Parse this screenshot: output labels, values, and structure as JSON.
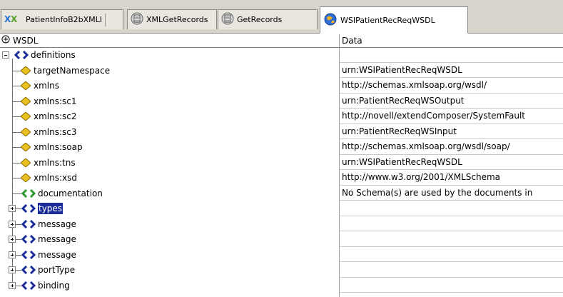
{
  "tabs": [
    {
      "label": "PatientInfoB2bXMLI",
      "icon": "xml-map-icon",
      "active": false
    },
    {
      "label": "XMLGetRecords",
      "icon": "database-component-icon",
      "active": false
    },
    {
      "label": "GetRecords",
      "icon": "database-component-icon",
      "active": false
    },
    {
      "label": "WSIPatientRecReqWSDL",
      "icon": "wsdl-globe-icon",
      "active": true
    }
  ],
  "header": {
    "tree_col": "WSDL",
    "data_col": "Data"
  },
  "rows": [
    {
      "label": "definitions",
      "kind": "element",
      "level": 0,
      "data": ""
    },
    {
      "label": "targetNamespace",
      "kind": "attribute",
      "level": 1,
      "data": "urn:WSIPatientRecReqWSDL"
    },
    {
      "label": "xmlns",
      "kind": "attribute",
      "level": 1,
      "data": "http://schemas.xmlsoap.org/wsdl/"
    },
    {
      "label": "xmlns:sc1",
      "kind": "attribute",
      "level": 1,
      "data": "urn:PatientRecReqWSOutput"
    },
    {
      "label": "xmlns:sc2",
      "kind": "attribute",
      "level": 1,
      "data": "http://novell/extendComposer/SystemFault"
    },
    {
      "label": "xmlns:sc3",
      "kind": "attribute",
      "level": 1,
      "data": "urn:PatientRecReqWSInput"
    },
    {
      "label": "xmlns:soap",
      "kind": "attribute",
      "level": 1,
      "data": "http://schemas.xmlsoap.org/wsdl/soap/"
    },
    {
      "label": "xmlns:tns",
      "kind": "attribute",
      "level": 1,
      "data": "urn:WSIPatientRecReqWSDL"
    },
    {
      "label": "xmlns:xsd",
      "kind": "attribute",
      "level": 1,
      "data": "http://www.w3.org/2001/XMLSchema"
    },
    {
      "label": "documentation",
      "kind": "text-element",
      "level": 1,
      "data": "No Schema(s) are used by the documents in"
    },
    {
      "label": "types",
      "kind": "collapsed",
      "level": 1,
      "data": "",
      "selected": true
    },
    {
      "label": "message",
      "kind": "collapsed",
      "level": 1,
      "data": ""
    },
    {
      "label": "message",
      "kind": "collapsed",
      "level": 1,
      "data": ""
    },
    {
      "label": "message",
      "kind": "collapsed",
      "level": 1,
      "data": ""
    },
    {
      "label": "portType",
      "kind": "collapsed",
      "level": 1,
      "data": ""
    },
    {
      "label": "binding",
      "kind": "collapsed",
      "level": 1,
      "data": ""
    }
  ],
  "colors": {
    "element_tag": "#1b2c9c",
    "text_tag": "#2e9a2e",
    "attribute": "#e8c020",
    "selection": "#1a2d9a"
  }
}
